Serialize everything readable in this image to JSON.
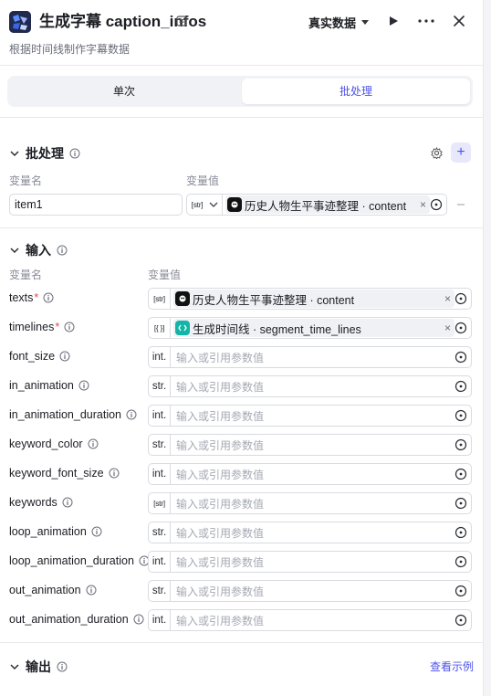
{
  "header": {
    "title": "生成字幕 caption_infos",
    "subtitle": "根据时间线制作字幕数据",
    "data_mode": "真实数据"
  },
  "tabs": [
    {
      "label": "单次",
      "active": false
    },
    {
      "label": "批处理",
      "active": true
    }
  ],
  "batch": {
    "title": "批处理",
    "col_name": "变量名",
    "col_value": "变量值",
    "item_name": "item1",
    "item_type": "[str]",
    "item_ref": "历史人物生平事迹整理 · content"
  },
  "inputs": {
    "title": "输入",
    "col_name": "变量名",
    "col_value": "变量值",
    "fields": [
      {
        "name": "texts",
        "required": true,
        "type": "[str]",
        "ref": "历史人物生平事迹整理 · content",
        "ref_kind": "llm"
      },
      {
        "name": "timelines",
        "required": true,
        "type": "[{ }]",
        "ref": "生成时间线 · segment_time_lines",
        "ref_kind": "code"
      },
      {
        "name": "font_size",
        "type": "int.",
        "placeholder": "输入或引用参数值"
      },
      {
        "name": "in_animation",
        "type": "str.",
        "placeholder": "输入或引用参数值"
      },
      {
        "name": "in_animation_duration",
        "type": "int.",
        "placeholder": "输入或引用参数值"
      },
      {
        "name": "keyword_color",
        "type": "str.",
        "placeholder": "输入或引用参数值"
      },
      {
        "name": "keyword_font_size",
        "type": "int.",
        "placeholder": "输入或引用参数值"
      },
      {
        "name": "keywords",
        "type": "[str]",
        "placeholder": "输入或引用参数值"
      },
      {
        "name": "loop_animation",
        "type": "str.",
        "placeholder": "输入或引用参数值"
      },
      {
        "name": "loop_animation_duration",
        "type": "int.",
        "placeholder": "输入或引用参数值"
      },
      {
        "name": "out_animation",
        "type": "str.",
        "placeholder": "输入或引用参数值"
      },
      {
        "name": "out_animation_duration",
        "type": "int.",
        "placeholder": "输入或引用参数值"
      }
    ]
  },
  "output": {
    "title": "输出",
    "example_link": "查看示例"
  },
  "colors": {
    "accent": "#4d53e8",
    "required": "#e5484d",
    "code_icon": "#13b5a6",
    "llm_icon": "#111111"
  }
}
